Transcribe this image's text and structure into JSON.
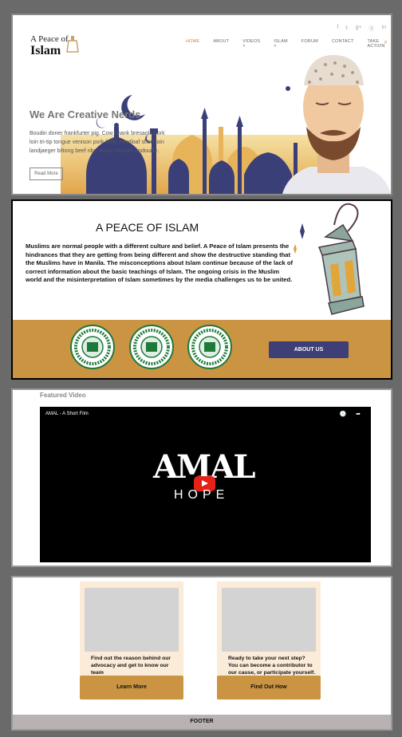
{
  "header": {
    "logo_line1": "A Peace of",
    "logo_line2": "Islam",
    "social_icons": [
      "facebook-icon",
      "twitter-icon",
      "google-plus-icon",
      "pinterest-icon",
      "linkedin-icon"
    ],
    "social": [
      "f",
      "𝕥",
      "g+",
      "ⓟ",
      "in"
    ],
    "nav": [
      "HOME",
      "ABOUT",
      "VIDEOS ˅",
      "ISLAM ˅",
      "FORUM",
      "CONTACT",
      "TAKE ACTION"
    ],
    "search_icon": "⌕"
  },
  "hero": {
    "title": "We Are Creative Nerds",
    "text": "Boudin doner frankfurter pig. Cow shank bresaola pork loin tri-tip tongue venison pork belly meatloaf short loin landjaeger biltong beef ribs shank chicken andouille.",
    "button": "Read More"
  },
  "about": {
    "title": "A PEACE OF ISLAM",
    "text": "Muslims are normal people with a different culture and belief. A Peace of Islam presents the hindrances that they are getting from being different and show the destructive standing that the Muslims have in Manila. The misconceptions about Islam continue because of the lack of correct information about the basic teachings of Islam. The ongoing crisis in the Muslim world and the misinterpretation of Islam sometimes by the media challenges us to be united.",
    "button": "ABOUT US",
    "colors": {
      "band": "#cb9442",
      "button": "#3d3f76",
      "seal": "#1f7a3a"
    }
  },
  "video": {
    "section_label": "Featured Video",
    "title": "AMAL - A Short Film",
    "headline": "AMAL",
    "subtitle": "HOPE",
    "icons": "🕓 ➦"
  },
  "cards": [
    {
      "text": "Find out the reason behind our advocacy and get to know our team",
      "button": "Learn More"
    },
    {
      "text": "Ready to take your next step? You can become a contributor to our cause, or participate yourself.",
      "button": "Find Out How"
    }
  ],
  "footer": {
    "label": "FOOTER"
  }
}
